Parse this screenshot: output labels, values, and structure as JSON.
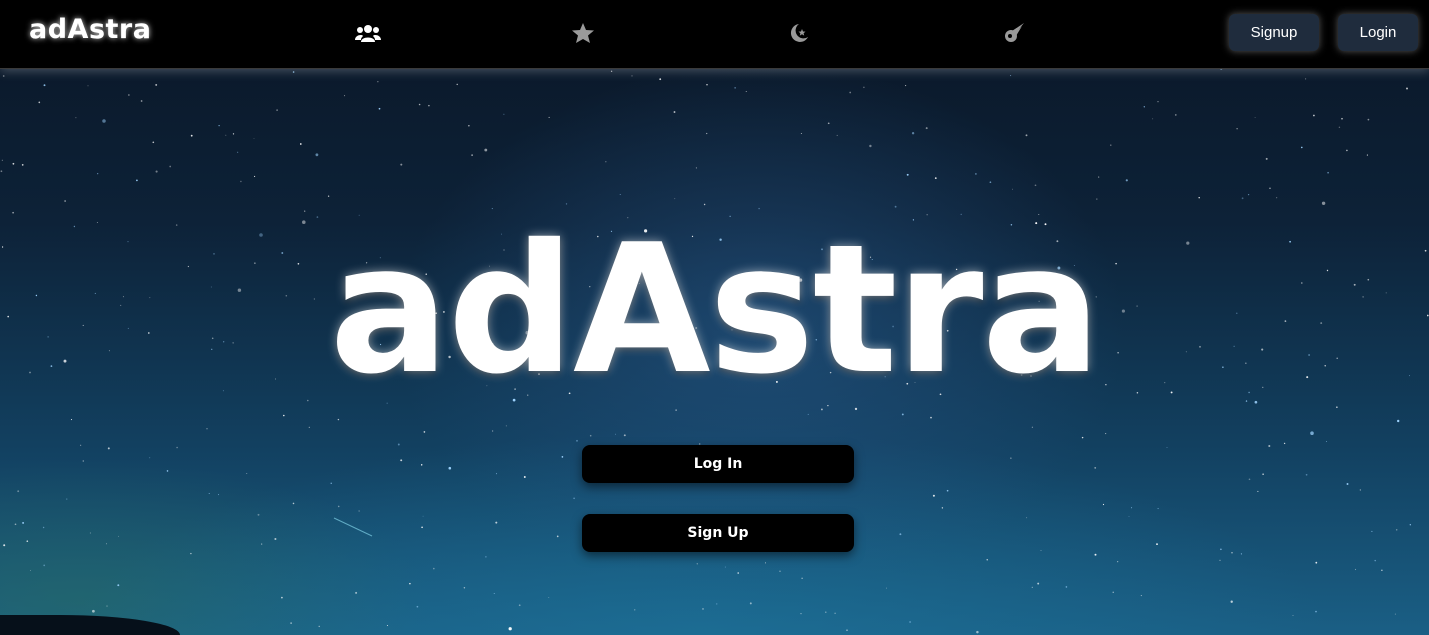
{
  "navbar": {
    "brand": "adAstra",
    "icons": [
      "users-icon",
      "star-icon",
      "moon-star-icon",
      "comet-icon"
    ],
    "signup_label": "Signup",
    "login_label": "Login"
  },
  "hero": {
    "title": "adAstra",
    "login_button": "Log In",
    "signup_button": "Sign Up"
  },
  "colors": {
    "navbar_bg": "#000000",
    "nav_button_bg": "#1f2c3d",
    "hero_button_bg": "#000000",
    "icon_color": "#9a9a9a"
  }
}
